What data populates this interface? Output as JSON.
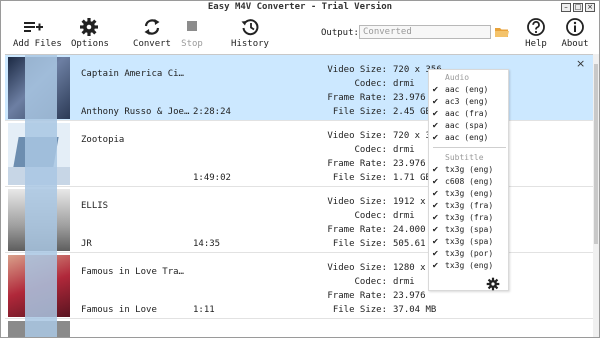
{
  "window": {
    "title": "Easy M4V Converter - Trial Version",
    "minimize_label": "–",
    "maximize_label": "□",
    "close_label": "×"
  },
  "toolbar": {
    "add_files": "Add Files",
    "options": "Options",
    "convert": "Convert",
    "stop": "Stop",
    "history": "History",
    "help": "Help",
    "about": "About",
    "output_label": "Output:",
    "output_placeholder": "Converted"
  },
  "list": {
    "close_label": "×",
    "labels": {
      "video_size": "Video Size:",
      "codec": "Codec:",
      "frame_rate": "Frame Rate:",
      "file_size": "File Size:"
    },
    "items": [
      {
        "title": "Captain America  Ci…",
        "subtitle": "Anthony Russo & Joe…",
        "duration": "2:28:24",
        "video_size": "720 x 356",
        "codec": "drmi",
        "frame_rate": "23.976",
        "file_size": "2.45 GB",
        "selected": true
      },
      {
        "title": "Zootopia",
        "subtitle": "",
        "duration": "1:49:02",
        "video_size": "720 x 356",
        "codec": "drmi",
        "frame_rate": "23.976",
        "file_size": "1.71 GB",
        "selected": false
      },
      {
        "title": "ELLIS",
        "subtitle": "JR",
        "duration": "14:35",
        "video_size": "1912 x 800",
        "codec": "drmi",
        "frame_rate": "24.000",
        "file_size": "505.61 MB",
        "selected": false
      },
      {
        "title": "Famous in Love  Tra…",
        "subtitle": "Famous in Love",
        "duration": "1:11",
        "video_size": "1280 x 718",
        "codec": "drmi",
        "frame_rate": "23.976",
        "file_size": "37.04 MB",
        "selected": false
      }
    ]
  },
  "tracks_popup": {
    "audio_header": "Audio",
    "subtitle_header": "Subtitle",
    "audio": [
      {
        "label": "aac  (eng)",
        "checked": true
      },
      {
        "label": "ac3  (eng)",
        "checked": true
      },
      {
        "label": "aac  (fra)",
        "checked": true
      },
      {
        "label": "aac  (spa)",
        "checked": true
      },
      {
        "label": "aac  (eng)",
        "checked": true
      }
    ],
    "subtitles": [
      {
        "label": "tx3g (eng)",
        "checked": true
      },
      {
        "label": "c608 (eng)",
        "checked": true
      },
      {
        "label": "tx3g (eng)",
        "checked": true
      },
      {
        "label": "tx3g (fra)",
        "checked": true
      },
      {
        "label": "tx3g (fra)",
        "checked": true
      },
      {
        "label": "tx3g (spa)",
        "checked": true
      },
      {
        "label": "tx3g (spa)",
        "checked": true
      },
      {
        "label": "tx3g (por)",
        "checked": true
      },
      {
        "label": "tx3g (eng)",
        "checked": true
      }
    ]
  },
  "colors": {
    "selected_row": "#cce8ff",
    "folder": "#e8a23a",
    "posters": [
      "#3b4c6b",
      "#6d8eb0",
      "#cfcfcf",
      "#b0283a"
    ]
  }
}
